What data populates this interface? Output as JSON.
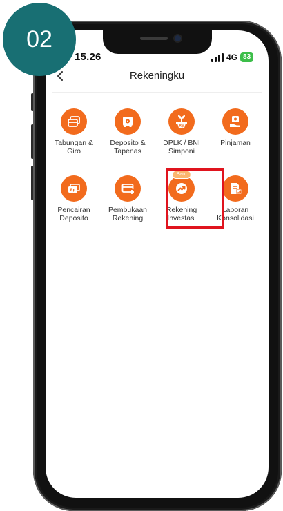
{
  "step_number": "02",
  "status_bar": {
    "time": "15.26",
    "network": "4G",
    "battery": "83"
  },
  "header": {
    "title": "Rekeningku"
  },
  "menu": [
    {
      "label": "Tabungan &\nGiro",
      "icon": "card-stack-icon"
    },
    {
      "label": "Deposito &\nTapenas",
      "icon": "safe-icon"
    },
    {
      "label": "DPLK / BNI\nSimponi",
      "icon": "plant-coin-icon"
    },
    {
      "label": "Pinjaman",
      "icon": "hand-money-icon"
    },
    {
      "label": "Pencairan\nDeposito",
      "icon": "cash-icon"
    },
    {
      "label": "Pembukaan\nRekening",
      "icon": "add-card-icon"
    },
    {
      "label": "Rekening\nInvestasi",
      "icon": "investment-icon",
      "badge": "Baru"
    },
    {
      "label": "Laporan\nKonsolidasi",
      "icon": "report-icon"
    }
  ],
  "colors": {
    "accent": "#f26b1d",
    "highlight": "#e0141e",
    "step_badge": "#186f73"
  }
}
